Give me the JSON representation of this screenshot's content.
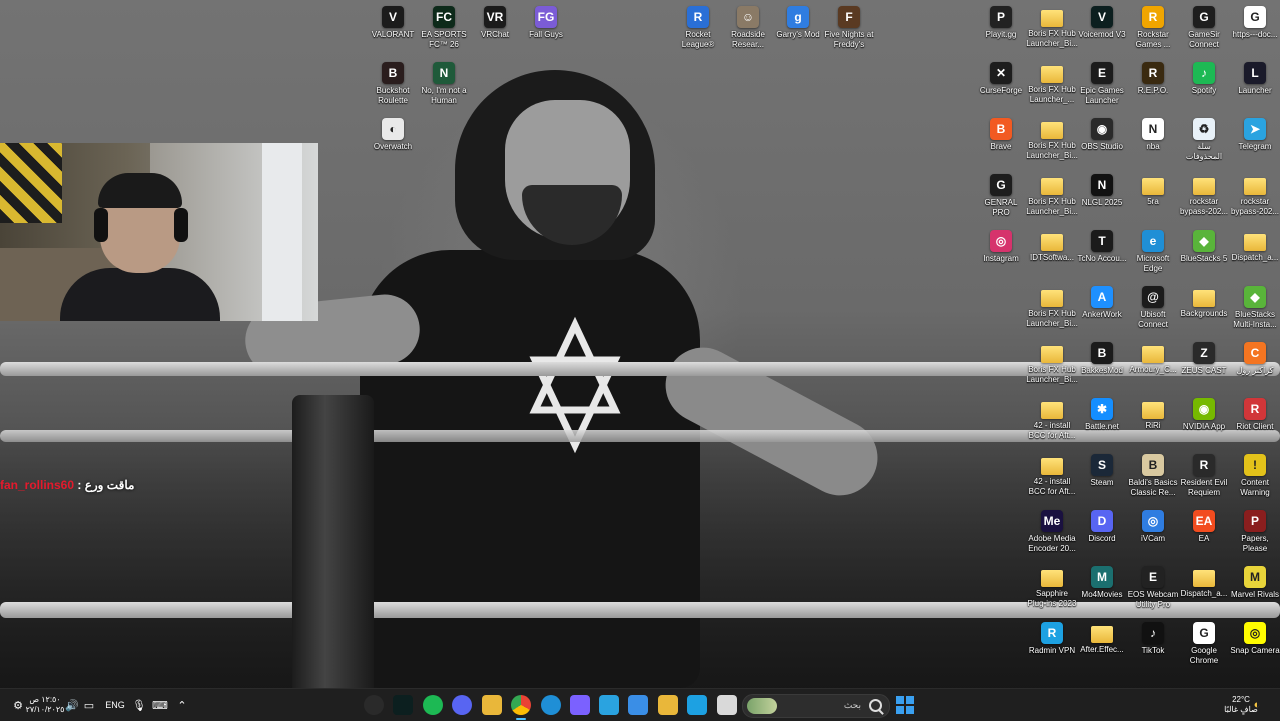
{
  "desktop_icons": [
    {
      "label": "VALORANT",
      "icon": "valorant-icon",
      "color": "#1b1b1b",
      "glyph": "V"
    },
    {
      "label": "EA SPORTS FC™ 26",
      "icon": "ea-fc-icon",
      "color": "#0d2a1a",
      "glyph": "FC"
    },
    {
      "label": "VRChat",
      "icon": "vrchat-icon",
      "color": "#1b1b1b",
      "glyph": "VR"
    },
    {
      "label": "Fall Guys",
      "icon": "fall-guys-icon",
      "color": "#7b5cd6",
      "glyph": "FG"
    },
    {
      "label": "Rocket League®",
      "icon": "rocket-league-icon",
      "color": "#2a6fd6",
      "glyph": "R"
    },
    {
      "label": "Roadside Resear...",
      "icon": "roadside-research-icon",
      "color": "#8a7a66",
      "glyph": "☺"
    },
    {
      "label": "Garry's Mod",
      "icon": "garrys-mod-icon",
      "color": "#2f7de1",
      "glyph": "g"
    },
    {
      "label": "Five Nights at Freddy's",
      "icon": "fnaf-icon",
      "color": "#5a3a22",
      "glyph": "F"
    },
    {
      "label": "Buckshot Roulette",
      "icon": "buckshot-roulette-icon",
      "color": "#2a1d1d",
      "glyph": "B"
    },
    {
      "label": "No, I'm not a Human",
      "icon": "not-a-human-icon",
      "color": "#1f5a3a",
      "glyph": "N"
    },
    {
      "label": "Overwatch",
      "icon": "overwatch-icon",
      "color": "#e9e9e9",
      "glyph": "◐"
    },
    {
      "label": "Playit.gg",
      "icon": "playit-icon",
      "color": "#222",
      "glyph": "P"
    },
    {
      "label": "Boris FX Hub Launcher_Bi...",
      "icon": "folder-icon",
      "color": "folder",
      "glyph": ""
    },
    {
      "label": "Voicemod V3",
      "icon": "voicemod-icon",
      "color": "#0c1f1f",
      "glyph": "V"
    },
    {
      "label": "Rockstar Games ...",
      "icon": "rockstar-icon",
      "color": "#f0a500",
      "glyph": "R"
    },
    {
      "label": "GameSir Connect",
      "icon": "gamesir-icon",
      "color": "#1e1e1e",
      "glyph": "G"
    },
    {
      "label": "https---doc...",
      "icon": "chrome-shortcut-icon",
      "color": "#ffffff",
      "glyph": "G"
    },
    {
      "label": "CurseForge",
      "icon": "curseforge-icon",
      "color": "#1d1d1d",
      "glyph": "✕"
    },
    {
      "label": "Boris FX Hub Launcher_...",
      "icon": "folder-icon",
      "color": "folder",
      "glyph": ""
    },
    {
      "label": "Epic Games Launcher",
      "icon": "epic-games-icon",
      "color": "#1c1c1c",
      "glyph": "E"
    },
    {
      "label": "R.E.P.O.",
      "icon": "repo-icon",
      "color": "#3a2a10",
      "glyph": "R"
    },
    {
      "label": "Spotify",
      "icon": "spotify-icon",
      "color": "#1db954",
      "glyph": "♪"
    },
    {
      "label": "Launcher",
      "icon": "launcher-icon",
      "color": "#1a1a2a",
      "glyph": "L"
    },
    {
      "label": "Brave",
      "icon": "brave-icon",
      "color": "#f25a22",
      "glyph": "B"
    },
    {
      "label": "Boris FX Hub Launcher_Bi...",
      "icon": "folder-icon",
      "color": "folder",
      "glyph": ""
    },
    {
      "label": "OBS Studio",
      "icon": "obs-icon",
      "color": "#2a2a2a",
      "glyph": "◉"
    },
    {
      "label": "nba",
      "icon": "nba-icon",
      "color": "#ffffff",
      "glyph": "N"
    },
    {
      "label": "سلة المحذوفات",
      "icon": "recycle-bin-icon",
      "color": "#e8f1f8",
      "glyph": "♻"
    },
    {
      "label": "Telegram",
      "icon": "telegram-icon",
      "color": "#2aa3e0",
      "glyph": "➤"
    },
    {
      "label": "GENRAL PRO",
      "icon": "genral-pro-icon",
      "color": "#1d1d1d",
      "glyph": "G"
    },
    {
      "label": "Boris FX Hub Launcher_Bi...",
      "icon": "folder-icon",
      "color": "folder",
      "glyph": ""
    },
    {
      "label": "NLGL 2025",
      "icon": "nlgl-icon",
      "color": "#111",
      "glyph": "N"
    },
    {
      "label": "5ra",
      "icon": "folder-icon",
      "color": "folder",
      "glyph": ""
    },
    {
      "label": "rockstar bypass-202...",
      "icon": "folder-icon",
      "color": "folder",
      "glyph": ""
    },
    {
      "label": "rockstar bypass-202...",
      "icon": "folder-icon",
      "color": "folder",
      "glyph": ""
    },
    {
      "label": "Instagram",
      "icon": "instagram-icon",
      "color": "#d6336c",
      "glyph": "◎"
    },
    {
      "label": "IDTSoftwa...",
      "icon": "folder-icon",
      "color": "folder",
      "glyph": ""
    },
    {
      "label": "TcNo Accou...",
      "icon": "tcno-icon",
      "color": "#1b1b1b",
      "glyph": "T"
    },
    {
      "label": "Microsoft Edge",
      "icon": "edge-icon",
      "color": "#1f8fd6",
      "glyph": "e"
    },
    {
      "label": "BlueStacks 5",
      "icon": "bluestacks-icon",
      "color": "#59b43a",
      "glyph": "◆"
    },
    {
      "label": "Dispatch_a...",
      "icon": "folder-icon",
      "color": "folder",
      "glyph": ""
    },
    {
      "label": "Boris FX Hub Launcher_Bi...",
      "icon": "folder-icon",
      "color": "folder",
      "glyph": ""
    },
    {
      "label": "AnkerWork",
      "icon": "ankerwork-icon",
      "color": "#1e90ff",
      "glyph": "A"
    },
    {
      "label": "Ubisoft Connect",
      "icon": "ubisoft-icon",
      "color": "#1b1b1b",
      "glyph": "@"
    },
    {
      "label": "Backgrounds",
      "icon": "folder-icon",
      "color": "folder",
      "glyph": ""
    },
    {
      "label": "BlueStacks Multi-Insta...",
      "icon": "bluestacks-multi-icon",
      "color": "#59b43a",
      "glyph": "◆"
    },
    {
      "label": "Boris FX Hub Launcher_Bi...",
      "icon": "folder-icon",
      "color": "folder",
      "glyph": ""
    },
    {
      "label": "BakkesMod",
      "icon": "bakkesmod-icon",
      "color": "#1b1b1b",
      "glyph": "B"
    },
    {
      "label": "Armoury_C...",
      "icon": "folder-icon",
      "color": "folder",
      "glyph": ""
    },
    {
      "label": "ZEUS CAST",
      "icon": "zeus-cast-icon",
      "color": "#2a2a2a",
      "glyph": "Z"
    },
    {
      "label": "كراكتر رول",
      "icon": "crunchyroll-icon",
      "color": "#f47521",
      "glyph": "C"
    },
    {
      "label": "42 - install BCC for Aft...",
      "icon": "folder-icon",
      "color": "folder",
      "glyph": ""
    },
    {
      "label": "Battle.net",
      "icon": "battlenet-icon",
      "color": "#148eff",
      "glyph": "✱"
    },
    {
      "label": "RiRi",
      "icon": "folder-icon",
      "color": "folder",
      "glyph": ""
    },
    {
      "label": "NVIDIA App",
      "icon": "nvidia-icon",
      "color": "#76b900",
      "glyph": "◉"
    },
    {
      "label": "Riot Client",
      "icon": "riot-client-icon",
      "color": "#d13639",
      "glyph": "R"
    },
    {
      "label": "42 - install BCC for Aft...",
      "icon": "folder-icon",
      "color": "folder",
      "glyph": ""
    },
    {
      "label": "Steam",
      "icon": "steam-icon",
      "color": "#1b2838",
      "glyph": "S"
    },
    {
      "label": "Baldi's Basics Classic Re...",
      "icon": "baldis-basics-icon",
      "color": "#d9c9a0",
      "glyph": "B"
    },
    {
      "label": "Resident Evil Requiem",
      "icon": "resident-evil-icon",
      "color": "#2a2a2a",
      "glyph": "R"
    },
    {
      "label": "Content Warning",
      "icon": "content-warning-icon",
      "color": "#e3c21a",
      "glyph": "!"
    },
    {
      "label": "Adobe Media Encoder 20...",
      "icon": "adobe-media-encoder-icon",
      "color": "#1a1140",
      "glyph": "Me"
    },
    {
      "label": "Discord",
      "icon": "discord-icon",
      "color": "#5865f2",
      "glyph": "D"
    },
    {
      "label": "iVCam",
      "icon": "ivcam-icon",
      "color": "#2f7de1",
      "glyph": "◎"
    },
    {
      "label": "EA",
      "icon": "ea-icon",
      "color": "#f24c1f",
      "glyph": "EA"
    },
    {
      "label": "Papers, Please",
      "icon": "papers-please-icon",
      "color": "#8a1e1e",
      "glyph": "P"
    },
    {
      "label": "Sapphire Plug-ins 2023",
      "icon": "folder-icon",
      "color": "folder",
      "glyph": ""
    },
    {
      "label": "Mo4Movies",
      "icon": "mo4movies-icon",
      "color": "#1b6f6f",
      "glyph": "M"
    },
    {
      "label": "EOS Webcam Utility Pro",
      "icon": "eos-webcam-icon",
      "color": "#222",
      "glyph": "E"
    },
    {
      "label": "Dispatch_a...",
      "icon": "folder-icon",
      "color": "folder",
      "glyph": ""
    },
    {
      "label": "Marvel Rivals",
      "icon": "marvel-rivals-icon",
      "color": "#e8d43a",
      "glyph": "M"
    },
    {
      "label": "Radmin VPN",
      "icon": "radmin-vpn-icon",
      "color": "#1da1e2",
      "glyph": "R"
    },
    {
      "label": "After.Effec...",
      "icon": "folder-icon",
      "color": "folder",
      "glyph": ""
    },
    {
      "label": "TikTok",
      "icon": "tiktok-icon",
      "color": "#111",
      "glyph": "♪"
    },
    {
      "label": "Google Chrome",
      "icon": "chrome-icon",
      "color": "#ffffff",
      "glyph": "G"
    },
    {
      "label": "Snap Camera",
      "icon": "snap-camera-icon",
      "color": "#fffc00",
      "glyph": "◎"
    }
  ],
  "chat": {
    "username": "fan_rollins60",
    "separator": ":",
    "message": "ماقت ورع"
  },
  "taskbar": {
    "weather": {
      "temp": "22°C",
      "condition": "صافٍ غالبًا"
    },
    "language": "ENG",
    "clock": {
      "time": "١٢:٥٠ ص",
      "date": "٢٧/١٠/٢٠٢٥"
    },
    "search_placeholder": "بحث",
    "pinned": [
      {
        "icon": "obs-icon",
        "color": "#2a2a2a"
      },
      {
        "icon": "voicemod-icon",
        "color": "#0c1f1f"
      },
      {
        "icon": "spotify-icon",
        "color": "#1db954"
      },
      {
        "icon": "discord-icon",
        "color": "#5865f2"
      },
      {
        "icon": "file-explorer-icon",
        "color": "#e9b73a"
      },
      {
        "icon": "chrome-icon",
        "color": "#ffffff"
      },
      {
        "icon": "edge-icon",
        "color": "#1f8fd6"
      },
      {
        "icon": "copilot-icon",
        "color": "#7b61ff"
      },
      {
        "icon": "telegram-icon",
        "color": "#2aa3e0"
      },
      {
        "icon": "microsoft-store-icon",
        "color": "#3a8ee6"
      },
      {
        "icon": "folder-icon",
        "color": "#e9b73a"
      },
      {
        "icon": "vpn-icon",
        "color": "#1da1e2"
      },
      {
        "icon": "blank-app-icon",
        "color": "#d9d9d9"
      }
    ]
  }
}
